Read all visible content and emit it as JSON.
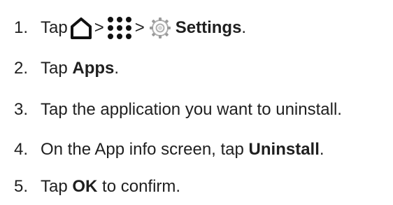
{
  "steps": [
    {
      "num": "1.",
      "parts": {
        "tap": "Tap",
        "sep1": ">",
        "sep2": ">",
        "settings": "Settings",
        "end": "."
      },
      "icons": [
        "home-icon",
        "apps-grid-icon",
        "settings-gear-icon"
      ]
    },
    {
      "num": "2.",
      "pre": "Tap ",
      "bold": "Apps",
      "post": "."
    },
    {
      "num": "3.",
      "pre": "Tap the application you want to uninstall.",
      "bold": "",
      "post": ""
    },
    {
      "num": "4.",
      "pre": "On the App info screen, tap ",
      "bold": "Uninstall",
      "post": "."
    },
    {
      "num": "5.",
      "pre": "Tap ",
      "bold": "OK",
      "post": " to confirm."
    }
  ]
}
